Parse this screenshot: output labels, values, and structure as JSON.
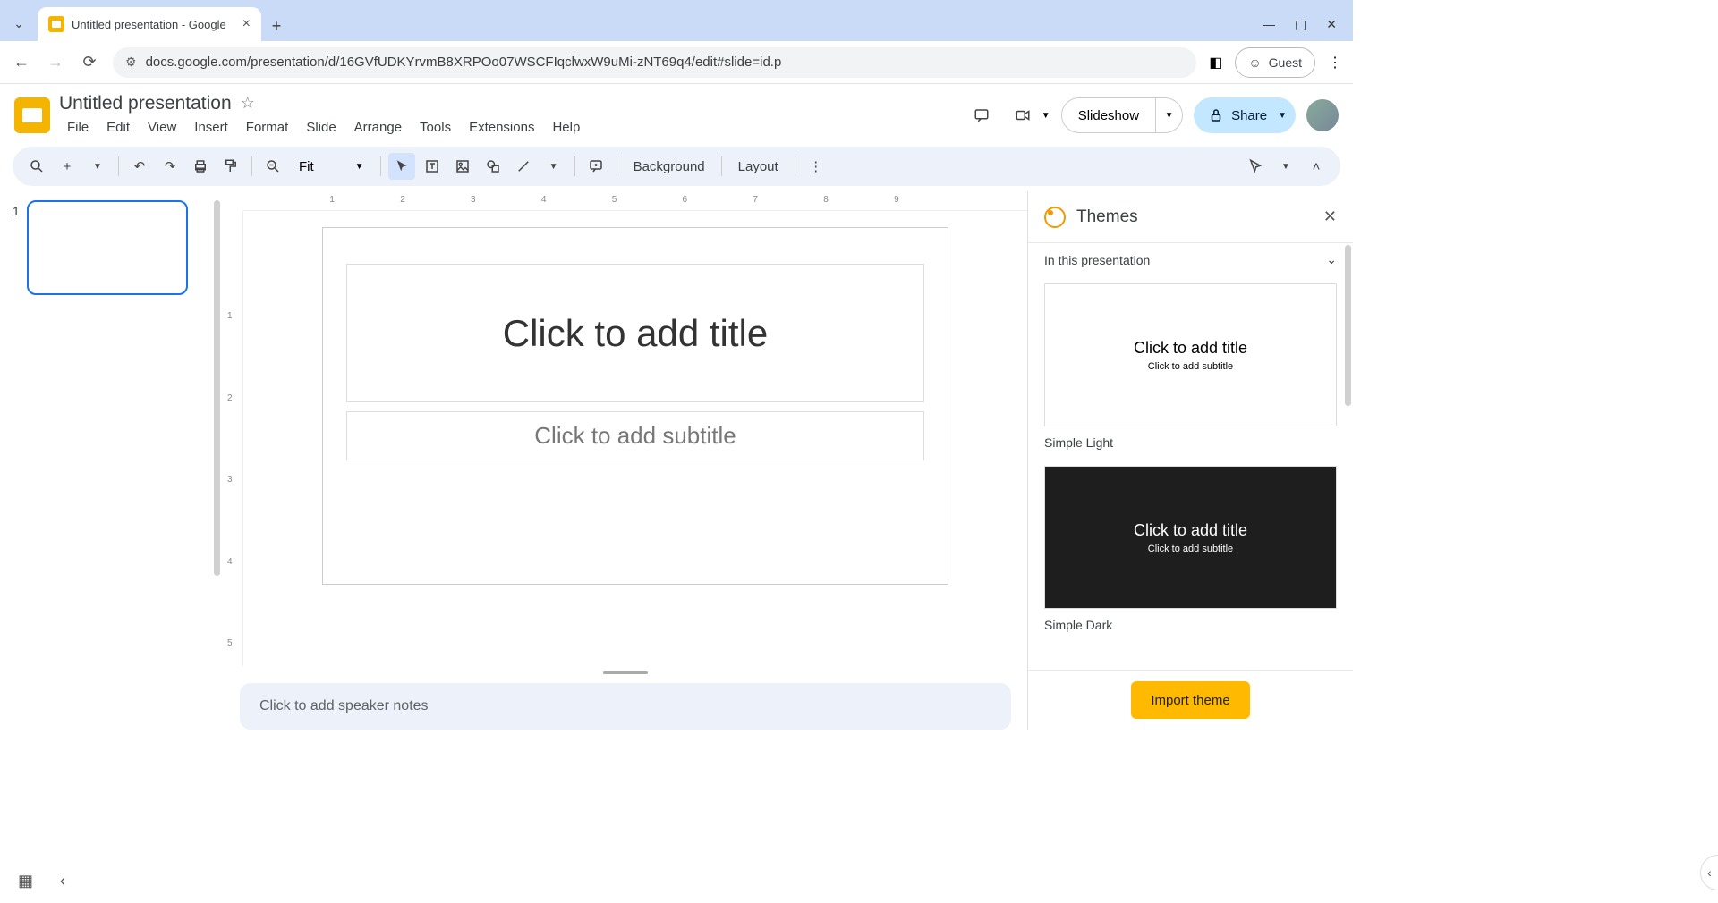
{
  "browser": {
    "tab_title": "Untitled presentation - Google",
    "url": "docs.google.com/presentation/d/16GVfUDKYrvmB8XRPOo07WSCFIqclwxW9uMi-zNT69q4/edit#slide=id.p",
    "guest_label": "Guest"
  },
  "document": {
    "title": "Untitled presentation"
  },
  "menubar": [
    "File",
    "Edit",
    "View",
    "Insert",
    "Format",
    "Slide",
    "Arrange",
    "Tools",
    "Extensions",
    "Help"
  ],
  "header": {
    "slideshow_label": "Slideshow",
    "share_label": "Share"
  },
  "toolbar": {
    "zoom_label": "Fit",
    "background_label": "Background",
    "layout_label": "Layout"
  },
  "slide": {
    "number": "1",
    "title_placeholder": "Click to add title",
    "subtitle_placeholder": "Click to add subtitle"
  },
  "ruler_h": [
    "1",
    "2",
    "3",
    "4",
    "5",
    "6",
    "7",
    "8",
    "9"
  ],
  "ruler_v": [
    "1",
    "2",
    "3",
    "4",
    "5"
  ],
  "notes": {
    "placeholder": "Click to add speaker notes"
  },
  "themes": {
    "title": "Themes",
    "section": "In this presentation",
    "items": [
      {
        "name": "Simple Light",
        "title": "Click to add title",
        "sub": "Click to add subtitle",
        "dark": false
      },
      {
        "name": "Simple Dark",
        "title": "Click to add title",
        "sub": "Click to add subtitle",
        "dark": true
      }
    ],
    "import_label": "Import theme"
  }
}
